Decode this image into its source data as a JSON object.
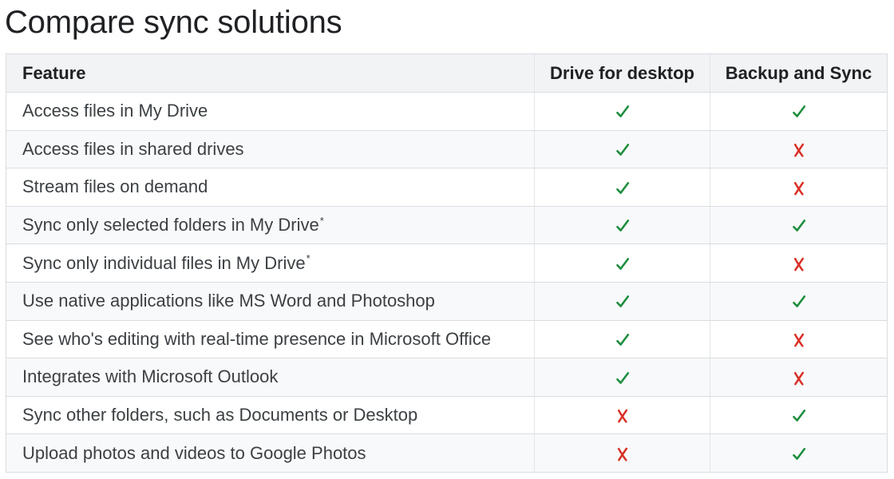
{
  "page": {
    "title": "Compare sync solutions"
  },
  "colors": {
    "check": "#1e8e3e",
    "cross": "#d93025",
    "header_bg": "#f1f3f4",
    "stripe_bg": "#f8f9fa",
    "border": "#dadce0"
  },
  "table": {
    "headers": {
      "feature": "Feature",
      "drive_for_desktop": "Drive for desktop",
      "backup_and_sync": "Backup and Sync"
    },
    "rows": [
      {
        "feature": "Access files in My Drive",
        "footnote": "",
        "drive_for_desktop": "check",
        "backup_and_sync": "check"
      },
      {
        "feature": "Access files in shared drives",
        "footnote": "",
        "drive_for_desktop": "check",
        "backup_and_sync": "cross"
      },
      {
        "feature": "Stream files on demand",
        "footnote": "",
        "drive_for_desktop": "check",
        "backup_and_sync": "cross"
      },
      {
        "feature": "Sync only selected folders in My Drive",
        "footnote": "*",
        "drive_for_desktop": "check",
        "backup_and_sync": "check"
      },
      {
        "feature": "Sync only individual files in My Drive",
        "footnote": "*",
        "drive_for_desktop": "check",
        "backup_and_sync": "cross"
      },
      {
        "feature": "Use native applications like MS Word and Photoshop",
        "footnote": "",
        "drive_for_desktop": "check",
        "backup_and_sync": "check"
      },
      {
        "feature": "See who's editing with real-time presence in Microsoft Office",
        "footnote": "",
        "drive_for_desktop": "check",
        "backup_and_sync": "cross"
      },
      {
        "feature": "Integrates with Microsoft Outlook",
        "footnote": "",
        "drive_for_desktop": "check",
        "backup_and_sync": "cross"
      },
      {
        "feature": "Sync other folders, such as Documents or Desktop",
        "footnote": "",
        "drive_for_desktop": "cross",
        "backup_and_sync": "check"
      },
      {
        "feature": "Upload photos and videos to Google Photos",
        "footnote": "",
        "drive_for_desktop": "cross",
        "backup_and_sync": "check"
      }
    ]
  }
}
